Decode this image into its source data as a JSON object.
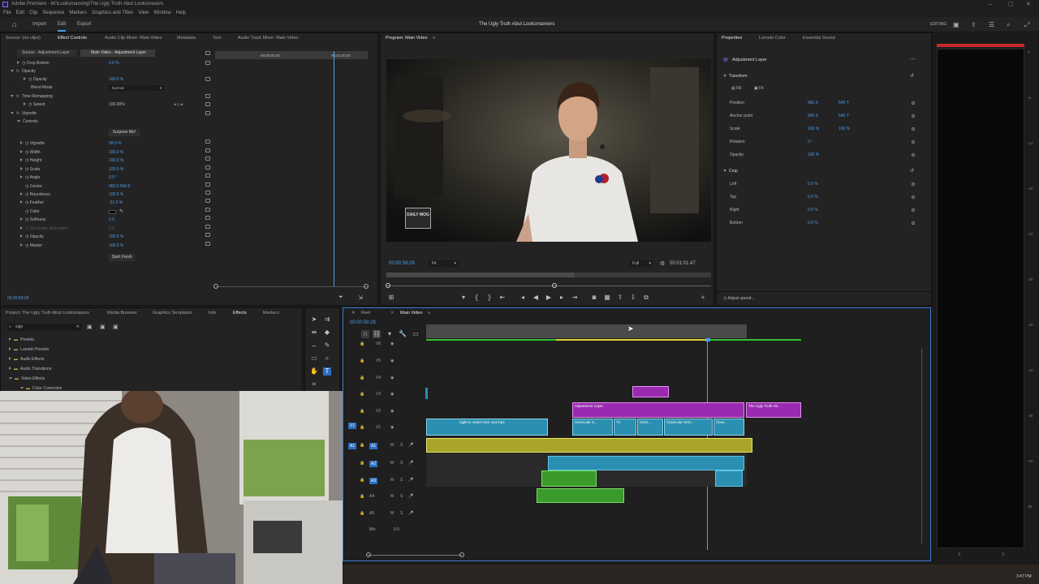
{
  "window": {
    "title": "Adobe Premiere - M:\\Looksmaxxing\\The Ugly Truth Abut Looksmaxers",
    "clock": "3:47 PM"
  },
  "menu": [
    "File",
    "Edit",
    "Clip",
    "Sequence",
    "Markers",
    "Graphics and Titles",
    "View",
    "Window",
    "Help"
  ],
  "appbar": {
    "tabs": [
      "Import",
      "Edit",
      "Export"
    ],
    "project_title": "The Ugly Truth Abut Looksmaxxers",
    "workspace": "EDITING"
  },
  "effect_controls": {
    "tabs": [
      "Source: (no clips)",
      "Effect Controls",
      "Audio Clip Mixer: Main Video",
      "Metadata",
      "Text",
      "Audio Track Mixer: Main Video"
    ],
    "source_label": "Source - Adjustment Layer",
    "target_label": "Main Video - Adjustment Layer",
    "ruler_time_1": "00;00;55;00",
    "ruler_time_2": "00;01;00;00",
    "rows": [
      {
        "label": "Crop Bottom",
        "value": "0.0 %"
      },
      {
        "label": "Opacity",
        "value": ""
      },
      {
        "label": "Opacity",
        "value": "100.0 %"
      },
      {
        "label": "Blend Mode",
        "value": "Normal"
      },
      {
        "label": "Time Remapping",
        "value": ""
      },
      {
        "label": "Speed",
        "value": "100.00%"
      },
      {
        "label": "Vignette",
        "value": ""
      },
      {
        "label": "Controls",
        "value": ""
      },
      {
        "label": "Vignette",
        "value": "99.0 %"
      },
      {
        "label": "Width",
        "value": "100.0 %"
      },
      {
        "label": "Height",
        "value": "100.0 %"
      },
      {
        "label": "Scale",
        "value": "100.0 %"
      },
      {
        "label": "Angle",
        "value": "0.0 °"
      },
      {
        "label": "Centre",
        "value": "960.0   540.0"
      },
      {
        "label": "Roundness",
        "value": "100.0 %"
      },
      {
        "label": "Feather",
        "value": "-31.0 %"
      },
      {
        "label": "Color",
        "value": ""
      },
      {
        "label": "Softness",
        "value": "0.0"
      },
      {
        "label": "Chromatic Aberration",
        "value": "0.0"
      },
      {
        "label": "Opacity",
        "value": "100.0 %"
      },
      {
        "label": "Master",
        "value": "100.0 %"
      }
    ],
    "surprise_button": "Surprise Me!",
    "start_fresh_button": "Start Fresh",
    "current_time": "00;00;59;29"
  },
  "program": {
    "title": "Program: Main Video",
    "watermark": "DAILY MOG",
    "timecode": "00:00:59:29",
    "fit": "Fit",
    "quality": "Full",
    "duration": "00:01:01:47"
  },
  "properties": {
    "tabs": [
      "Properties",
      "Lumetri Color",
      "Essential Sound"
    ],
    "layer": "Adjustment Layer",
    "transform_header": "Transform",
    "fill": "Fill",
    "fit": "Fit",
    "rows": [
      {
        "label": "Position",
        "v1": "960 X",
        "v2": "540 Y"
      },
      {
        "label": "Anchor point",
        "v1": "960 X",
        "v2": "540 Y"
      },
      {
        "label": "Scale",
        "v1": "100 %",
        "v2": "100 %"
      },
      {
        "label": "Rotation",
        "v1": "0 °",
        "v2": ""
      },
      {
        "label": "Opacity",
        "v1": "100 %",
        "v2": ""
      }
    ],
    "crop_header": "Crop",
    "crop_rows": [
      {
        "label": "Left",
        "v1": "0.0 %"
      },
      {
        "label": "Top",
        "v1": "0.0 %"
      },
      {
        "label": "Right",
        "v1": "0.0 %"
      },
      {
        "label": "Bottom",
        "v1": "0.0 %"
      }
    ],
    "adjust_speed": "Adjust speed..."
  },
  "project_panel": {
    "tabs": [
      "Project: The Ugly Truth Abut Looksmaxers",
      "Media Browser",
      "Graphics Templates",
      "Info",
      "Effects",
      "Markers"
    ],
    "search": "vign",
    "tree": [
      "Presets",
      "Lumetri Presets",
      "Audio Effects",
      "Audio Transitions",
      "Video Effects",
      "Color Correction"
    ]
  },
  "timeline": {
    "tabs": [
      "Reel",
      "Main Video"
    ],
    "timecode": "00:00:59:29",
    "video_tracks": [
      "V6",
      "V5",
      "V4",
      "V3",
      "V2",
      "V1"
    ],
    "audio_tracks": [
      "A1",
      "A2",
      "A3",
      "A4",
      "A5"
    ],
    "source_patch_v": "V1",
    "source_patch_a": "A1",
    "mix_label": "Mix",
    "mix_value": "0.0",
    "clips": {
      "v2_adj": "Adjustment Layer",
      "v2_title": "The Ugly Truth Ab...",
      "v1_a": "night in miami clan vod.mp4",
      "v1_b": "Clavicular S...",
      "v1_c": "Clavi...",
      "v1_d": "Clavicular SHU...",
      "v1_e": "Clavi...",
      "v1_f": "TV"
    }
  },
  "meter_scale": [
    "0",
    "-6",
    "-12",
    "-18",
    "-24",
    "-30",
    "-36",
    "-42",
    "-48",
    "-54",
    "dB"
  ]
}
